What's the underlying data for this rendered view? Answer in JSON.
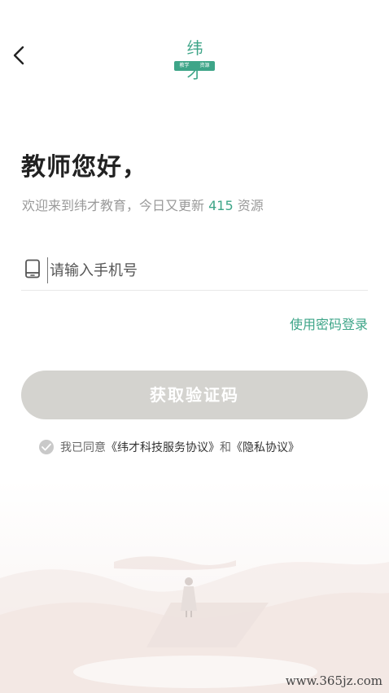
{
  "nav": {
    "back_icon": "chevron-left-icon"
  },
  "logo": {
    "text": "纬才",
    "tags": [
      "教学",
      "资源"
    ]
  },
  "header": {
    "title": "教师您好，",
    "subtitle_prefix": "欢迎来到纬才教育，今日又更新 ",
    "update_count": "415",
    "subtitle_suffix": " 资源"
  },
  "phone": {
    "icon": "phone-icon",
    "placeholder": "请输入手机号",
    "value": ""
  },
  "password_login_link": "使用密码登录",
  "get_code_button": "获取验证码",
  "agreement": {
    "prefix": "我已同意",
    "terms_link": "《纬才科技服务协议》",
    "connector": "和",
    "privacy_link": "《隐私协议》"
  },
  "watermark": "www.365jz.com",
  "colors": {
    "accent": "#3ea588",
    "button_disabled": "#d4d3cf",
    "text_primary": "#222222",
    "text_secondary": "#9a9a9a"
  }
}
